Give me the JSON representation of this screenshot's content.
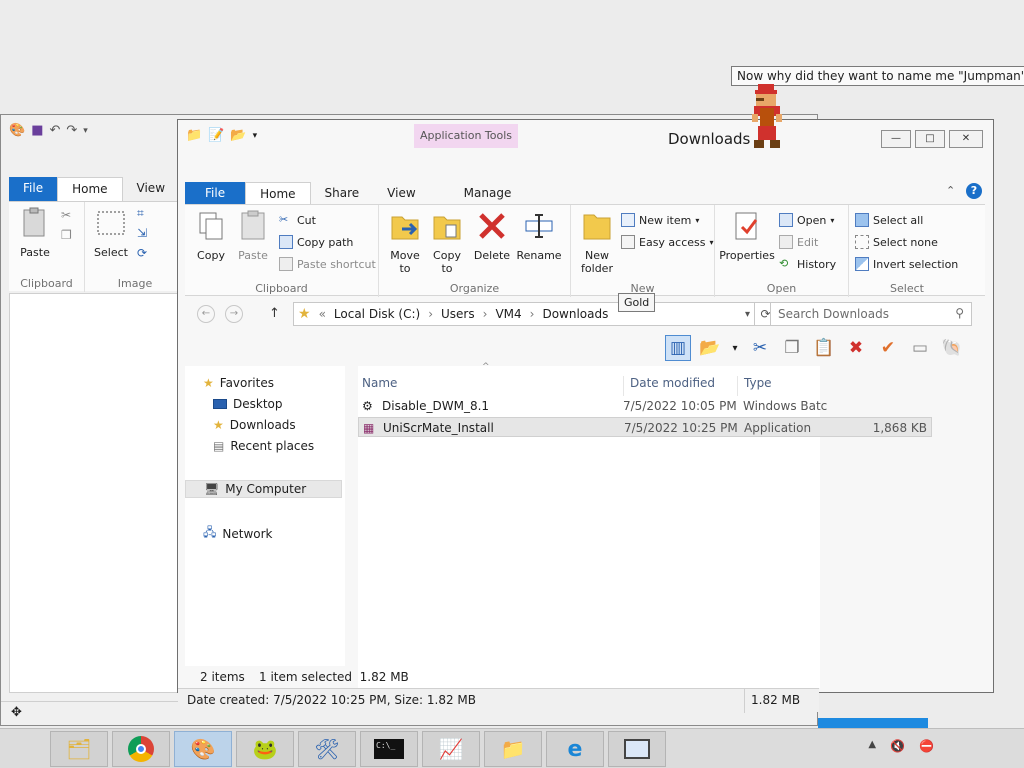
{
  "paint": {
    "tabs": {
      "file": "File",
      "home": "Home",
      "view": "View"
    },
    "groups": {
      "clipboard": "Clipboard",
      "image": "Image"
    },
    "buttons": {
      "paste": "Paste",
      "select": "Select"
    }
  },
  "explorer": {
    "title": "Downloads",
    "context_tab": "Application Tools",
    "window_buttons": {
      "minimize": "—",
      "maximize": "□",
      "close": "✕"
    },
    "tabs": {
      "file": "File",
      "home": "Home",
      "share": "Share",
      "view": "View",
      "manage": "Manage"
    },
    "ribbon": {
      "clipboard": {
        "label": "Clipboard",
        "copy": "Copy",
        "paste": "Paste",
        "cut": "Cut",
        "copy_path": "Copy path",
        "paste_shortcut": "Paste shortcut"
      },
      "organize": {
        "label": "Organize",
        "move_to": "Move to",
        "copy_to": "Copy to",
        "delete": "Delete",
        "rename": "Rename"
      },
      "new": {
        "label": "New",
        "new_folder": "New folder",
        "new_item": "New item",
        "easy_access": "Easy access"
      },
      "open": {
        "label": "Open",
        "properties": "Properties",
        "open": "Open",
        "edit": "Edit",
        "history": "History"
      },
      "select": {
        "label": "Select",
        "select_all": "Select all",
        "select_none": "Select none",
        "invert": "Invert selection"
      }
    },
    "address": {
      "prefix": "«",
      "crumbs": [
        "Local Disk (C:)",
        "Users",
        "VM4",
        "Downloads"
      ],
      "search_placeholder": "Search Downloads"
    },
    "nav": {
      "favorites": "Favorites",
      "desktop": "Desktop",
      "downloads": "Downloads",
      "recent": "Recent places",
      "computer": "My Computer",
      "network": "Network"
    },
    "columns": {
      "name": "Name",
      "date": "Date modified",
      "type": "Type"
    },
    "files": [
      {
        "name": "Disable_DWM_8.1",
        "date": "7/5/2022 10:05 PM",
        "type": "Windows Batc",
        "size": ""
      },
      {
        "name": "UniScrMate_Install",
        "date": "7/5/2022 10:25 PM",
        "type": "Application",
        "size": "1,868 KB"
      }
    ],
    "status": {
      "items": "2 items",
      "selected": "1 item selected  1.82 MB"
    },
    "details": {
      "left": "Date created: 7/5/2022 10:25 PM, Size: 1.82 MB",
      "right": "1.82 MB"
    }
  },
  "tooltips": {
    "gold": "Gold",
    "mario": "Now why did they want to name me \"Jumpman\"??"
  }
}
